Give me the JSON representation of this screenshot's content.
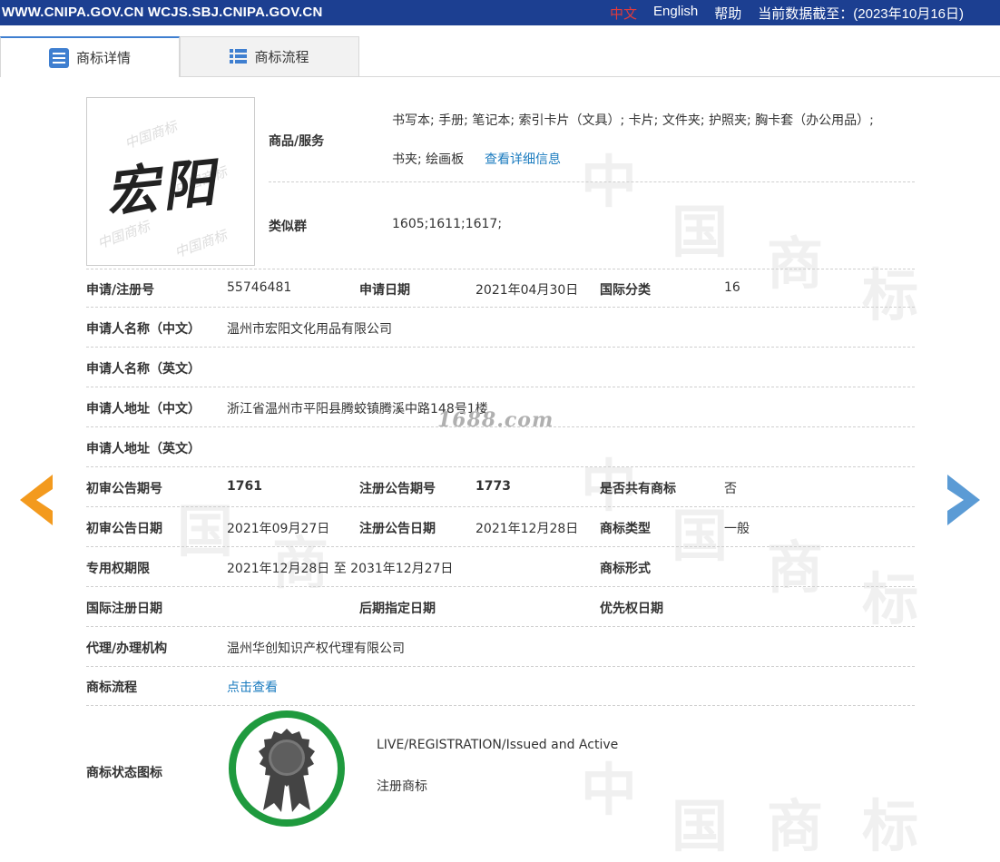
{
  "topbar": {
    "site": "WWW.CNIPA.GOV.CN WCJS.SBJ.CNIPA.GOV.CN",
    "lang_cn": "中文",
    "lang_en": "English",
    "help": "帮助",
    "data_as_of": "当前数据截至：(2023年10月16日)"
  },
  "tabs": [
    {
      "label": "商标详情"
    },
    {
      "label": "商标流程"
    }
  ],
  "trademark_image": {
    "text": "宏阳"
  },
  "goods": {
    "label": "商品/服务",
    "line1": "书写本; 手册; 笔记本; 索引卡片（文具）; 卡片; 文件夹; 护照夹; 胸卡套（办公用品）;",
    "line2": "书夹; 绘画板",
    "detail_link": "查看详细信息"
  },
  "similar_group": {
    "label": "类似群",
    "value": "1605;1611;1617;"
  },
  "rows": {
    "reg_no_label": "申请/注册号",
    "reg_no": "55746481",
    "app_date_label": "申请日期",
    "app_date": "2021年04月30日",
    "intl_class_label": "国际分类",
    "intl_class": "16",
    "applicant_cn_label": "申请人名称（中文）",
    "applicant_cn": "温州市宏阳文化用品有限公司",
    "applicant_en_label": "申请人名称（英文）",
    "address_cn_label": "申请人地址（中文）",
    "address_cn": "浙江省温州市平阳县腾蛟镇腾溪中路148号1楼",
    "address_en_label": "申请人地址（英文）",
    "prelim_no_label": "初审公告期号",
    "prelim_no": "1761",
    "reg_pub_no_label": "注册公告期号",
    "reg_pub_no": "1773",
    "shared_label": "是否共有商标",
    "shared": "否",
    "prelim_date_label": "初审公告日期",
    "prelim_date": "2021年09月27日",
    "reg_pub_date_label": "注册公告日期",
    "reg_pub_date": "2021年12月28日",
    "tm_type_label": "商标类型",
    "tm_type": "一般",
    "exclusive_label": "专用权期限",
    "exclusive": "2021年12月28日 至 2031年12月27日",
    "tm_form_label": "商标形式",
    "intl_reg_date_label": "国际注册日期",
    "later_date_label": "后期指定日期",
    "priority_label": "优先权日期",
    "agent_label": "代理/办理机构",
    "agent": "温州华创知识产权代理有限公司",
    "flow_label": "商标流程",
    "flow_link": "点击查看",
    "status_label": "商标状态图标",
    "status_en": "LIVE/REGISTRATION/Issued and Active",
    "status_cn": "注册商标"
  },
  "overlay_watermark": "1688.com",
  "colors": {
    "topbar": "#1c3f91",
    "link": "#1a7bbf",
    "prev_arrow": "#f39a1e",
    "next_arrow": "#5b9bd5",
    "status_ring": "#1f9a3e"
  },
  "icons": {
    "prev": "chevron-left-icon",
    "next": "chevron-right-icon",
    "tab1": "document-list-icon",
    "tab2": "list-icon",
    "status": "rosette-icon"
  }
}
